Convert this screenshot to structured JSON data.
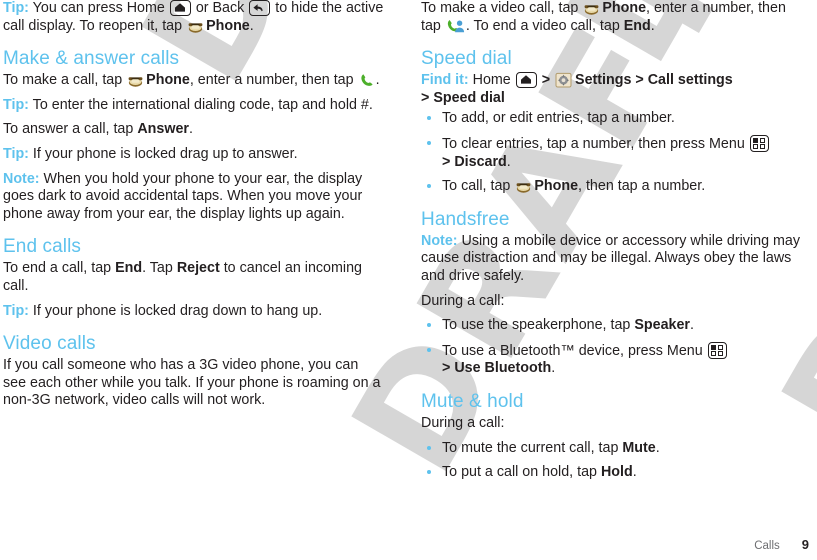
{
  "page": {
    "chapter_label": "Calls",
    "page_number": "9",
    "watermark_text": "DRAFT",
    "heading_color": "#5ec2ed",
    "body_color": "#231f20",
    "watermark_color": "#d6d6d6"
  },
  "left_column": {
    "tip_reopen": {
      "label": "Tip:",
      "text_1": " You can press Home ",
      "text_2": " or Back ",
      "text_3": " to hide the active call display. To reopen it, tap ",
      "text_4": "Phone",
      "text_5": "."
    },
    "make_answer": {
      "heading": "Make & answer calls",
      "p1_a": "To make a call, tap ",
      "p1_b": "Phone",
      "p1_c": ", enter a number, then tap ",
      "p1_d": ".",
      "tip_intl_label": "Tip:",
      "tip_intl_text": " To enter the international dialing code, tap and hold #.",
      "p2_a": "To answer a call, tap ",
      "p2_b": "Answer",
      "p2_c": ".",
      "tip_locked_label": "Tip:",
      "tip_locked_text": " If your phone is locked drag up to answer.",
      "note_label": "Note:",
      "note_text": " When you hold your phone to your ear, the display goes dark to avoid accidental taps. When you move your phone away from your ear, the display lights up again."
    },
    "end_calls": {
      "heading": "End calls",
      "p1_a": "To end a call, tap ",
      "p1_b": "End",
      "p1_c": ". Tap ",
      "p1_d": "Reject",
      "p1_e": " to cancel an incoming call.",
      "tip_label": "Tip:",
      "tip_text": " If your phone is locked drag down to hang up."
    },
    "video_calls": {
      "heading": "Video calls",
      "p1": "If you call someone who has a 3G video phone, you can see each other while you talk. If your phone is roaming on a non-3G network, video calls will not work."
    }
  },
  "right_column": {
    "video_call_intro": {
      "a": "To make a video call, tap ",
      "b": "Phone",
      "c": ", enter a number, then tap ",
      "d": ". To end a video call, tap ",
      "e": "End",
      "f": "."
    },
    "speed_dial": {
      "heading": "Speed dial",
      "findit_label": "Find it:",
      "findit_home": " Home ",
      "findit_sep1": " > ",
      "findit_settings": "Settings",
      "findit_sep2": " > ",
      "findit_callsettings": "Call settings",
      "findit_sep3": "> ",
      "findit_speeddial": "Speed dial",
      "bullets": [
        {
          "text_a": "To add, or edit entries, tap a number.",
          "bold": "",
          "text_b": ""
        },
        {
          "text_a": "To clear entries, tap a number, then press Menu ",
          "bold": "Discard",
          "text_b": ".",
          "prefix_bold": "> "
        },
        {
          "text_a": "To call, tap ",
          "bold": "Phone",
          "text_b": ", then tap a number."
        }
      ]
    },
    "handsfree": {
      "heading": "Handsfree",
      "note_label": "Note:",
      "note_text": " Using a mobile device or accessory while driving may cause distraction and may be illegal. Always obey the laws and drive safely.",
      "during_call": "During a call:",
      "bullets": [
        {
          "text_a": "To use the speakerphone, tap ",
          "bold": "Speaker",
          "text_b": "."
        },
        {
          "text_a": "To use a Bluetooth™ device, press Menu ",
          "bold": "Use Bluetooth",
          "text_b": ".",
          "prefix_bold": "> "
        }
      ]
    },
    "mute_hold": {
      "heading": "Mute & hold",
      "during_call": "During a call:",
      "bullets": [
        {
          "text_a": "To mute the current call, tap ",
          "bold": "Mute",
          "text_b": "."
        },
        {
          "text_a": "To put a call on hold, tap ",
          "bold": "Hold",
          "text_b": "."
        }
      ]
    }
  },
  "icons": {
    "home_key": "home-key-icon",
    "back_key": "back-key-icon",
    "menu_key": "menu-key-icon",
    "phone_app": "phone-app-icon",
    "green_handset": "green-handset-icon",
    "video_call": "video-call-icon",
    "settings_app": "settings-app-icon"
  }
}
